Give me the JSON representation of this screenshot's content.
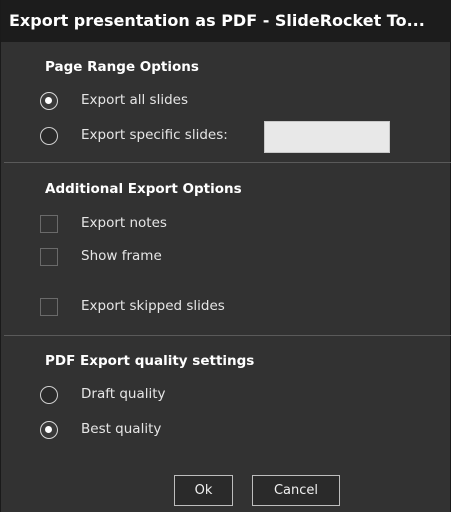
{
  "window": {
    "title": "Export presentation as PDF - SlideRocket To..."
  },
  "page_range": {
    "heading": "Page Range Options",
    "options": [
      {
        "label": "Export all slides",
        "selected": true
      },
      {
        "label": "Export specific slides:",
        "selected": false
      }
    ],
    "specific_slides_value": ""
  },
  "additional": {
    "heading": "Additional Export Options",
    "options": [
      {
        "label": "Export notes",
        "checked": false
      },
      {
        "label": "Show frame",
        "checked": false
      },
      {
        "label": "Export skipped slides",
        "checked": false
      }
    ]
  },
  "quality": {
    "heading": "PDF Export quality settings",
    "options": [
      {
        "label": "Draft quality",
        "selected": false
      },
      {
        "label": "Best quality",
        "selected": true
      }
    ]
  },
  "buttons": {
    "ok": "Ok",
    "cancel": "Cancel"
  }
}
